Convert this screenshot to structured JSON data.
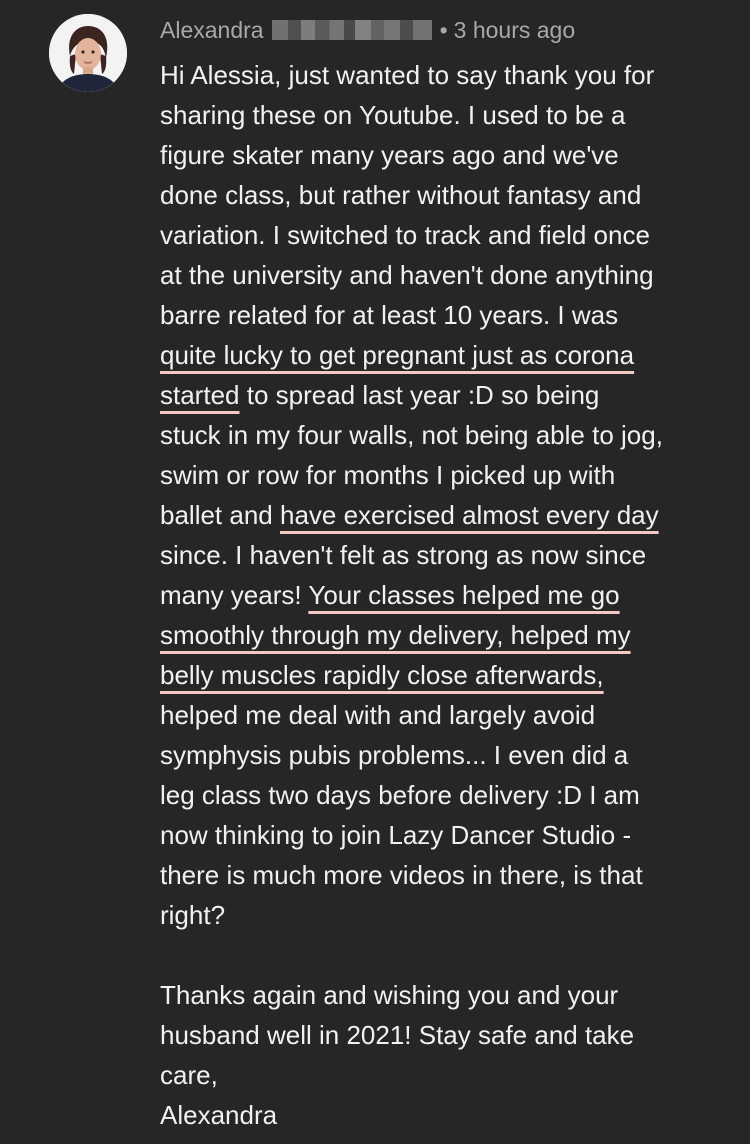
{
  "comment": {
    "author": "Alexandra",
    "separator": "•",
    "time": "3 hours ago",
    "avatar_icon": "user-avatar-photo",
    "underline_color": "#f3c9c4",
    "lines": [
      "Hi Alessia, just wanted to say thank you for",
      "sharing these on Youtube. I used to be a",
      "figure skater many years ago and we've",
      "done class, but rather without fantasy and",
      "variation. I switched to track and field once",
      "at the university and haven't done anything",
      "barre related for at least 10 years. I was",
      "quite lucky to get pregnant just as corona",
      "started",
      " to spread last year :D so being",
      "stuck in my four walls, not being able to jog,",
      "swim or row for months I picked up with",
      "ballet and ",
      "have exercised almost every day",
      "since. I haven't felt as strong as now since",
      "many years! ",
      "Your classes helped me go",
      "smoothly through my delivery, helped my",
      "belly muscles rapidly close afterwards,",
      "helped me deal with and largely avoid",
      "symphysis pubis problems... I even did a",
      "leg class two days before delivery :D I am",
      "now thinking to join Lazy Dancer Studio -",
      "there is much more videos in there, is that",
      "right?",
      "Thanks again and wishing you and your",
      "husband well in 2021! Stay safe and take",
      "care,",
      "Alexandra"
    ]
  }
}
